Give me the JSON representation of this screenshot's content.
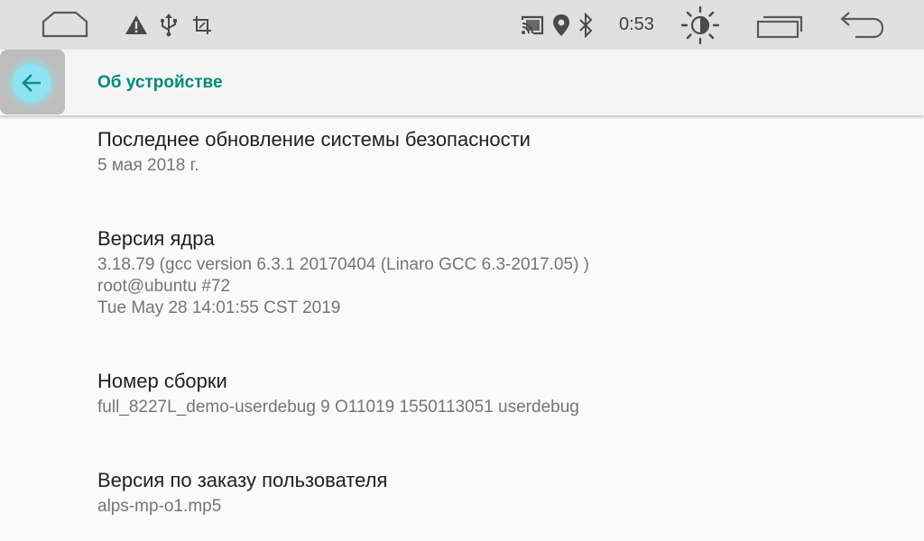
{
  "status_bar": {
    "clock": "0:53",
    "icons_left": [
      "home-outline-icon",
      "warning-icon",
      "usb-icon",
      "screenshot-icon"
    ],
    "icons_right": [
      "cast-icon",
      "location-icon",
      "bluetooth-icon",
      "brightness-icon",
      "recents-icon",
      "back-nav-icon"
    ]
  },
  "toolbar": {
    "title": "Об устройстве",
    "back_icon": "arrow-back-icon",
    "accent_color": "#00897b"
  },
  "items": [
    {
      "title": "Последнее обновление системы безопасности",
      "summary": "5 мая 2018 г."
    },
    {
      "title": "Версия ядра",
      "summary": "3.18.79 (gcc version 6.3.1 20170404 (Linaro GCC 6.3-2017.05) )\nroot@ubuntu #72\nTue May 28 14:01:55 CST 2019"
    },
    {
      "title": "Номер сборки",
      "summary": "full_8227L_demo-userdebug 9 O11019 1550113051 userdebug"
    },
    {
      "title": "Версия по заказу пользователя",
      "summary": "alps-mp-o1.mp5"
    }
  ]
}
